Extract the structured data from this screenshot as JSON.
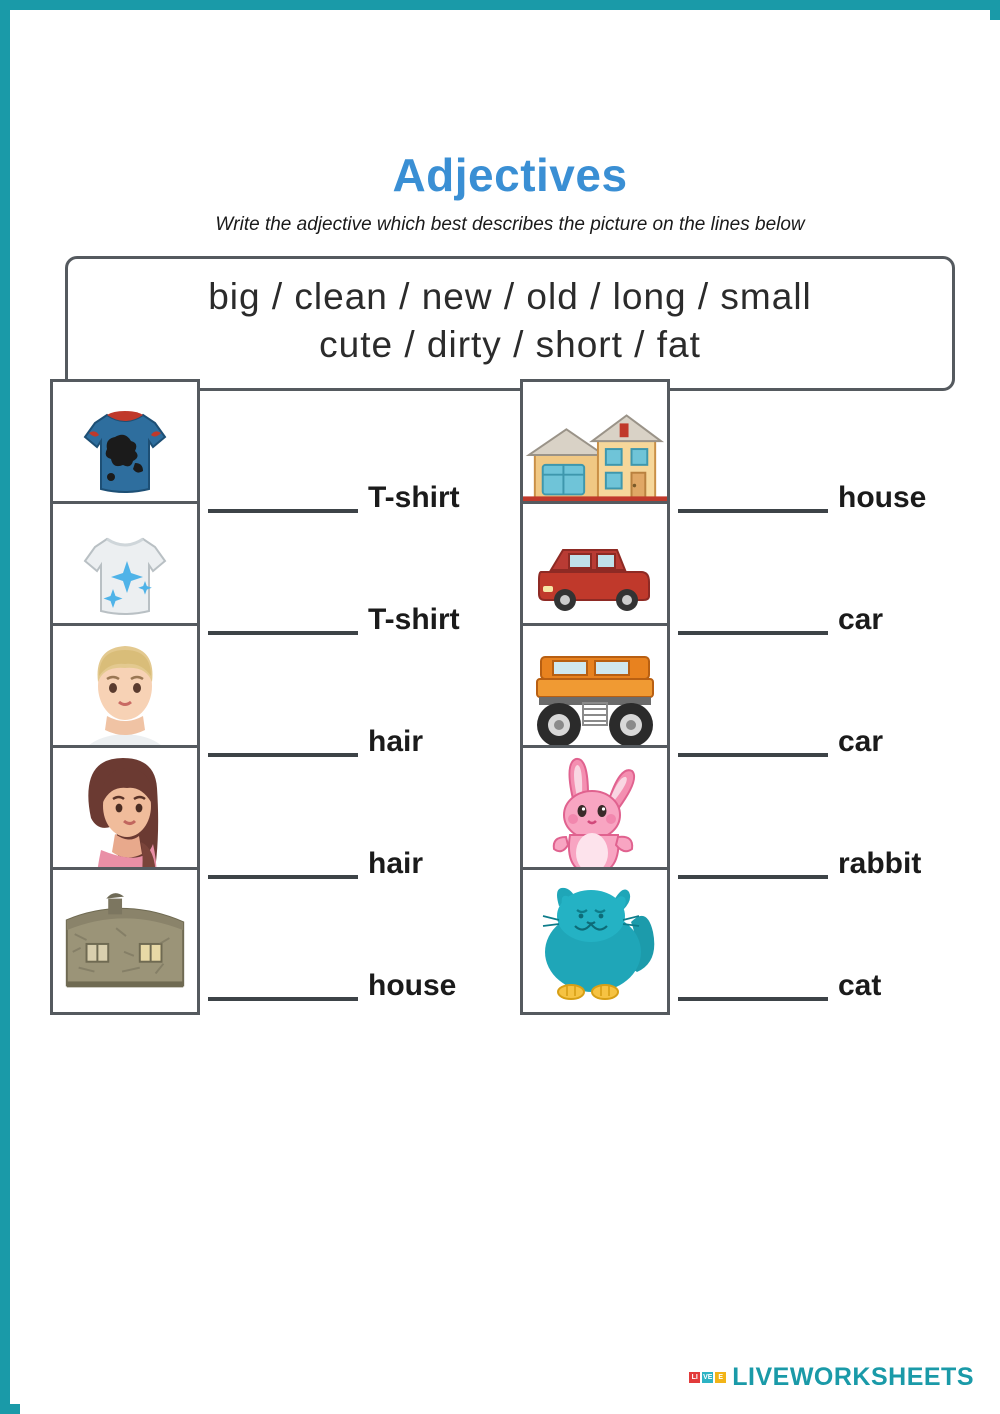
{
  "page": {
    "title": "Adjectives",
    "subtitle": "Write the adjective which best describes the picture on the lines below",
    "border_color": "#1a9aa8",
    "title_color": "#3a8fd4"
  },
  "wordbank": {
    "row1": "big  /  clean  /  new  /  old  /  long  /  small",
    "row2": "cute  /  dirty  /  short  /  fat",
    "words": [
      "big",
      "clean",
      "new",
      "old",
      "long",
      "small",
      "cute",
      "dirty",
      "short",
      "fat"
    ]
  },
  "exercises": {
    "left": [
      {
        "image": "dirty-tshirt-icon",
        "answer_value": "",
        "word": "T-shirt"
      },
      {
        "image": "clean-tshirt-icon",
        "answer_value": "",
        "word": "T-shirt"
      },
      {
        "image": "short-hair-woman-icon",
        "answer_value": "",
        "word": "hair"
      },
      {
        "image": "long-hair-woman-icon",
        "answer_value": "",
        "word": "hair"
      },
      {
        "image": "old-stone-house-icon",
        "answer_value": "",
        "word": "house"
      }
    ],
    "right": [
      {
        "image": "new-house-icon",
        "answer_value": "",
        "word": "house"
      },
      {
        "image": "small-red-car-icon",
        "answer_value": "",
        "word": "car"
      },
      {
        "image": "big-orange-monster-truck-icon",
        "answer_value": "",
        "word": "car"
      },
      {
        "image": "cute-pink-rabbit-icon",
        "answer_value": "",
        "word": "rabbit"
      },
      {
        "image": "fat-teal-cat-icon",
        "answer_value": "",
        "word": "cat"
      }
    ]
  },
  "footer": {
    "brand": "LIVEWORKSHEETS",
    "logo_letters": [
      "LI",
      "VE",
      "E"
    ],
    "brand_color": "#1a9aa8"
  }
}
